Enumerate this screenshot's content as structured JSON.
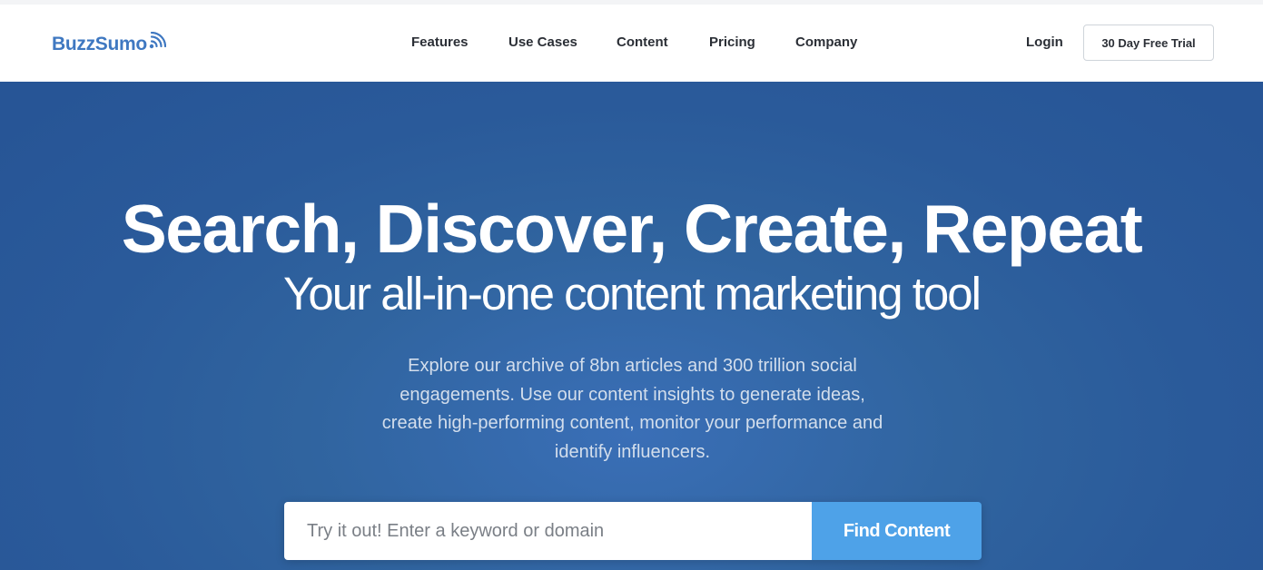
{
  "brand": {
    "name": "BuzzSumo",
    "color": "#3f78c1",
    "icon": "signal-waves-icon"
  },
  "nav": {
    "items": [
      {
        "label": "Features"
      },
      {
        "label": "Use Cases"
      },
      {
        "label": "Content"
      },
      {
        "label": "Pricing"
      },
      {
        "label": "Company"
      }
    ],
    "login_label": "Login",
    "trial_label": "30 Day Free Trial"
  },
  "hero": {
    "title": "Search, Discover, Create, Repeat",
    "subtitle": "Your all-in-one content marketing tool",
    "description": "Explore our archive of 8bn articles and 300 trillion social engagements. Use our content insights to generate ideas, create high-performing content, monitor your performance and identify influencers.",
    "background_color": "#2b5a9b"
  },
  "search": {
    "placeholder": "Try it out! Enter a keyword or domain",
    "value": "",
    "button_label": "Find Content",
    "button_color": "#4ea2e8"
  }
}
